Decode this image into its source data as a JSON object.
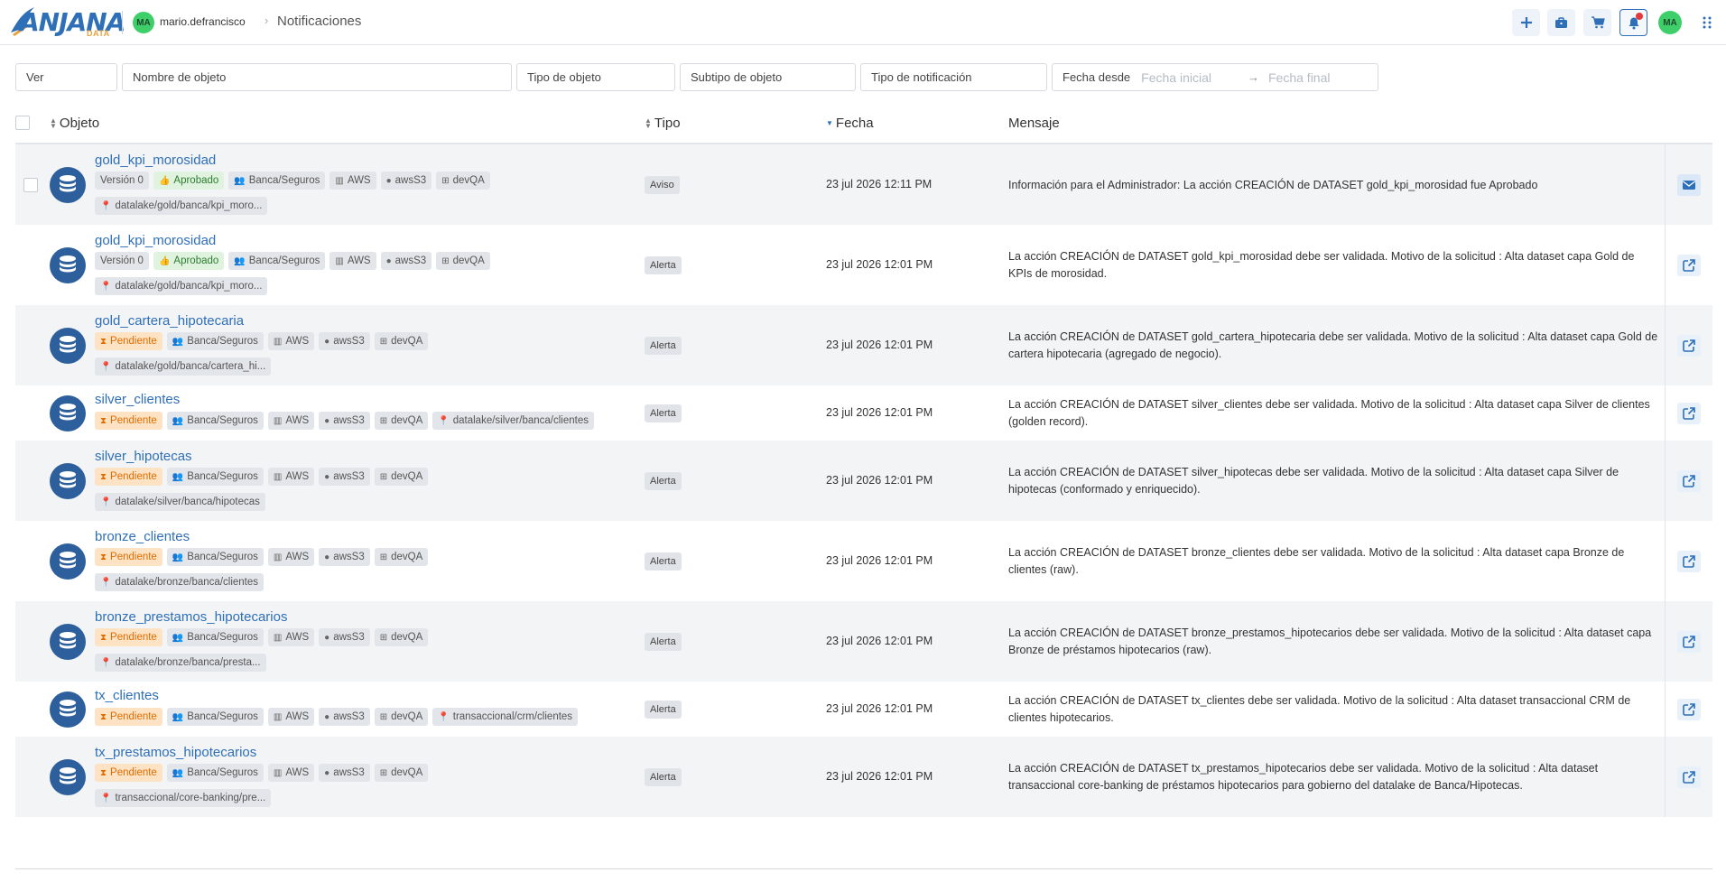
{
  "header": {
    "logo_text": "ANJANA",
    "logo_sub": "DATA",
    "user_initials": "MA",
    "user_name": "mario.defrancisco",
    "breadcrumb_current": "Notificaciones",
    "avatar_initials": "MA"
  },
  "filters": {
    "ver": "Ver",
    "nombre": "Nombre de objeto",
    "tipo_objeto": "Tipo de objeto",
    "subtipo": "Subtipo de objeto",
    "tipo_notificacion": "Tipo de notificación",
    "fecha_desde": "Fecha desde",
    "fecha_inicial": "Fecha inicial",
    "fecha_final": "Fecha final"
  },
  "columns": {
    "objeto": "Objeto",
    "tipo": "Tipo",
    "fecha": "Fecha",
    "mensaje": "Mensaje"
  },
  "rows": [
    {
      "name": "gold_kpi_morosidad",
      "chips": [
        "Versión 0",
        "Aprobado",
        "Banca/Seguros",
        "AWS",
        "awsS3",
        "devQA"
      ],
      "path": "datalake/gold/banca/kpi_moro...",
      "tipo": "Aviso",
      "fecha": "23 jul 2026 12:11 PM",
      "mensaje": "Información para el Administrador: La acción CREACIÓN de DATASET gold_kpi_morosidad fue Aprobado"
    },
    {
      "name": "gold_kpi_morosidad",
      "chips": [
        "Versión 0",
        "Aprobado",
        "Banca/Seguros",
        "AWS",
        "awsS3",
        "devQA"
      ],
      "path": "datalake/gold/banca/kpi_moro...",
      "tipo": "Alerta",
      "fecha": "23 jul 2026 12:01 PM",
      "mensaje": "La acción CREACIÓN de DATASET gold_kpi_morosidad debe ser validada. Motivo de la solicitud : Alta dataset capa Gold de KPIs de morosidad."
    },
    {
      "name": "gold_cartera_hipotecaria",
      "chips": [
        "Pendiente",
        "Banca/Seguros",
        "AWS",
        "awsS3",
        "devQA"
      ],
      "path": "datalake/gold/banca/cartera_hi...",
      "tipo": "Alerta",
      "fecha": "23 jul 2026 12:01 PM",
      "mensaje": "La acción CREACIÓN de DATASET gold_cartera_hipotecaria debe ser validada. Motivo de la solicitud : Alta dataset capa Gold de cartera hipotecaria (agregado de negocio)."
    },
    {
      "name": "silver_clientes",
      "chips": [
        "Pendiente",
        "Banca/Seguros",
        "AWS",
        "awsS3",
        "devQA",
        "datalake/silver/banca/clientes"
      ],
      "path": "",
      "tipo": "Alerta",
      "fecha": "23 jul 2026 12:01 PM",
      "mensaje": "La acción CREACIÓN de DATASET silver_clientes debe ser validada. Motivo de la solicitud : Alta dataset capa Silver de clientes (golden record)."
    },
    {
      "name": "silver_hipotecas",
      "chips": [
        "Pendiente",
        "Banca/Seguros",
        "AWS",
        "awsS3",
        "devQA"
      ],
      "path": "datalake/silver/banca/hipotecas",
      "tipo": "Alerta",
      "fecha": "23 jul 2026 12:01 PM",
      "mensaje": "La acción CREACIÓN de DATASET silver_hipotecas debe ser validada. Motivo de la solicitud : Alta dataset capa Silver de hipotecas (conformado y enriquecido)."
    },
    {
      "name": "bronze_clientes",
      "chips": [
        "Pendiente",
        "Banca/Seguros",
        "AWS",
        "awsS3",
        "devQA"
      ],
      "path": "datalake/bronze/banca/clientes",
      "tipo": "Alerta",
      "fecha": "23 jul 2026 12:01 PM",
      "mensaje": "La acción CREACIÓN de DATASET bronze_clientes debe ser validada. Motivo de la solicitud : Alta dataset capa Bronze de clientes (raw)."
    },
    {
      "name": "bronze_prestamos_hipotecarios",
      "chips": [
        "Pendiente",
        "Banca/Seguros",
        "AWS",
        "awsS3",
        "devQA"
      ],
      "path": "datalake/bronze/banca/presta...",
      "tipo": "Alerta",
      "fecha": "23 jul 2026 12:01 PM",
      "mensaje": "La acción CREACIÓN de DATASET bronze_prestamos_hipotecarios debe ser validada. Motivo de la solicitud : Alta dataset capa Bronze de préstamos hipotecarios (raw)."
    },
    {
      "name": "tx_clientes",
      "chips": [
        "Pendiente",
        "Banca/Seguros",
        "AWS",
        "awsS3",
        "devQA",
        "transaccional/crm/clientes"
      ],
      "path": "",
      "tipo": "Alerta",
      "fecha": "23 jul 2026 12:01 PM",
      "mensaje": "La acción CREACIÓN de DATASET tx_clientes debe ser validada. Motivo de la solicitud : Alta dataset transaccional CRM de clientes hipotecarios."
    },
    {
      "name": "tx_prestamos_hipotecarios",
      "chips": [
        "Pendiente",
        "Banca/Seguros",
        "AWS",
        "awsS3",
        "devQA"
      ],
      "path": "transaccional/core-banking/pre...",
      "tipo": "Alerta",
      "fecha": "23 jul 2026 12:01 PM",
      "mensaje": "La acción CREACIÓN de DATASET tx_prestamos_hipotecarios debe ser validada. Motivo de la solicitud : Alta dataset transaccional core-banking de préstamos hipotecarios para gobierno del datalake de Banca/Hipotecas."
    }
  ],
  "colors": {
    "brand": "#2e6fb7",
    "db_icon": "#2d5f9c",
    "approved_bg": "#dff3de",
    "pending_bg": "#fde2c4",
    "notification_dot": "#e0393e",
    "avatar": "#3ecf6a"
  },
  "icons": {
    "toolbar": [
      "plus-icon",
      "briefcase-icon",
      "cart-icon",
      "bell-icon",
      "avatar",
      "grid-icon"
    ],
    "row_action_first": "envelope-icon",
    "row_action_rest": "external-link-icon"
  }
}
